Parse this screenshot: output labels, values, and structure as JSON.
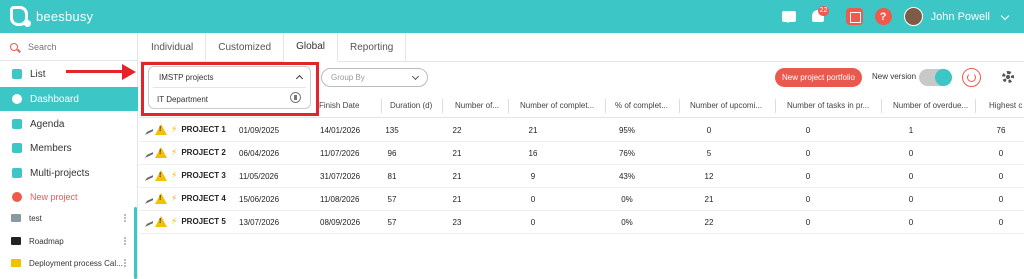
{
  "app": {
    "logo_text": "beesbusy"
  },
  "topbar": {
    "notification_count": "22",
    "help_label": "?",
    "user_name": "John Powell"
  },
  "sidebar": {
    "search_placeholder": "Search",
    "nav": [
      {
        "label": "List",
        "icon": "list-icon"
      },
      {
        "label": "Dashboard",
        "icon": "dashboard-icon",
        "active": true
      },
      {
        "label": "Agenda",
        "icon": "calendar-icon"
      },
      {
        "label": "Members",
        "icon": "members-icon"
      },
      {
        "label": "Multi-projects",
        "icon": "multi-projects-icon"
      }
    ],
    "new_project_label": "New project",
    "folders": [
      {
        "label": "test",
        "color": "#8a9aa3"
      },
      {
        "label": "Roadmap",
        "color": "#222222"
      },
      {
        "label": "Deployment process Cal...",
        "color": "#f2c200"
      }
    ]
  },
  "tabs": [
    "Individual",
    "Customized",
    "Global",
    "Reporting"
  ],
  "active_tab": "Global",
  "toolbar": {
    "portfolio_select": {
      "value": "IMSTP projects",
      "option": "IT Department"
    },
    "group_by_placeholder": "Group By",
    "new_portfolio_label": "New project portfolio",
    "new_version_label": "New version",
    "new_version_on": true
  },
  "table": {
    "columns": [
      "Finish Date",
      "Duration (d)",
      "Number of...",
      "Number of complet...",
      "% of complet...",
      "Number of upcomi...",
      "Number of tasks in pr...",
      "Number of overdue...",
      "Highest c"
    ],
    "rows": [
      {
        "name": "PROJECT 1",
        "start": "01/09/2025",
        "finish": "14/01/2026",
        "duration": "135",
        "tasks": "22",
        "completed": "21",
        "pct": "95%",
        "upcoming": "0",
        "in_progress": "0",
        "overdue": "1",
        "highest": "76"
      },
      {
        "name": "PROJECT 2",
        "start": "06/04/2026",
        "finish": "11/07/2026",
        "duration": "96",
        "tasks": "21",
        "completed": "16",
        "pct": "76%",
        "upcoming": "5",
        "in_progress": "0",
        "overdue": "0",
        "highest": "0"
      },
      {
        "name": "PROJECT 3",
        "start": "11/05/2026",
        "finish": "31/07/2026",
        "duration": "81",
        "tasks": "21",
        "completed": "9",
        "pct": "43%",
        "upcoming": "12",
        "in_progress": "0",
        "overdue": "0",
        "highest": "0"
      },
      {
        "name": "PROJECT 4",
        "start": "15/06/2026",
        "finish": "11/08/2026",
        "duration": "57",
        "tasks": "21",
        "completed": "0",
        "pct": "0%",
        "upcoming": "21",
        "in_progress": "0",
        "overdue": "0",
        "highest": "0"
      },
      {
        "name": "PROJECT 5",
        "start": "13/07/2026",
        "finish": "08/09/2026",
        "duration": "57",
        "tasks": "23",
        "completed": "0",
        "pct": "0%",
        "upcoming": "22",
        "in_progress": "0",
        "overdue": "0",
        "highest": "0"
      }
    ]
  },
  "colors": {
    "accent": "#3cc6c6",
    "brand_red": "#ef5a4c",
    "highlight": "#e4232a"
  }
}
